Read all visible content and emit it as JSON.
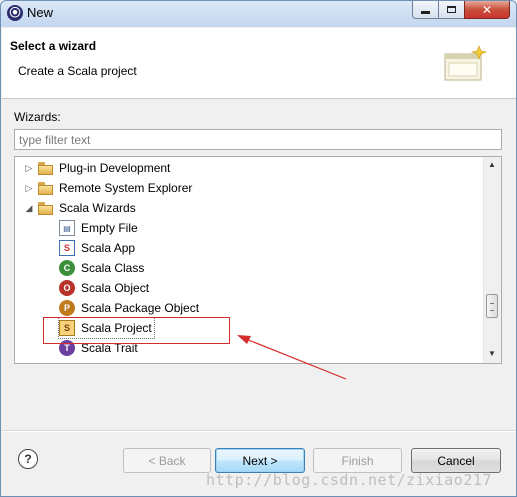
{
  "window": {
    "title": "New",
    "icon": "eclipse-icon",
    "controls": [
      "minimize",
      "maximize",
      "close"
    ]
  },
  "header": {
    "title": "Select a wizard",
    "description": "Create a Scala project",
    "banner_icon": "wizard-banner-icon"
  },
  "wizards": {
    "label": "Wizards:",
    "filter_placeholder": "type filter text",
    "tree": [
      {
        "label": "Plug-in Development",
        "type": "folder",
        "expanded": false
      },
      {
        "label": "Remote System Explorer",
        "type": "folder",
        "expanded": false
      },
      {
        "label": "Scala Wizards",
        "type": "folder",
        "expanded": true
      },
      {
        "label": "Empty File",
        "type": "item",
        "icon": "file-icon"
      },
      {
        "label": "Scala App",
        "type": "item",
        "icon": "scala-app-icon"
      },
      {
        "label": "Scala Class",
        "type": "item",
        "icon": "scala-class-icon"
      },
      {
        "label": "Scala Object",
        "type": "item",
        "icon": "scala-object-icon"
      },
      {
        "label": "Scala Package Object",
        "type": "item",
        "icon": "scala-package-object-icon"
      },
      {
        "label": "Scala Project",
        "type": "item",
        "icon": "scala-project-icon",
        "selected": true
      },
      {
        "label": "Scala Trait",
        "type": "item",
        "icon": "scala-trait-icon"
      }
    ]
  },
  "buttons": {
    "help": "?",
    "back": "< Back",
    "next": "Next >",
    "finish": "Finish",
    "cancel": "Cancel"
  },
  "watermark": "http://blog.csdn.net/zixiao217",
  "colors": {
    "annotation": "#d42b2b",
    "default_button_border": "#3c7fb1"
  }
}
